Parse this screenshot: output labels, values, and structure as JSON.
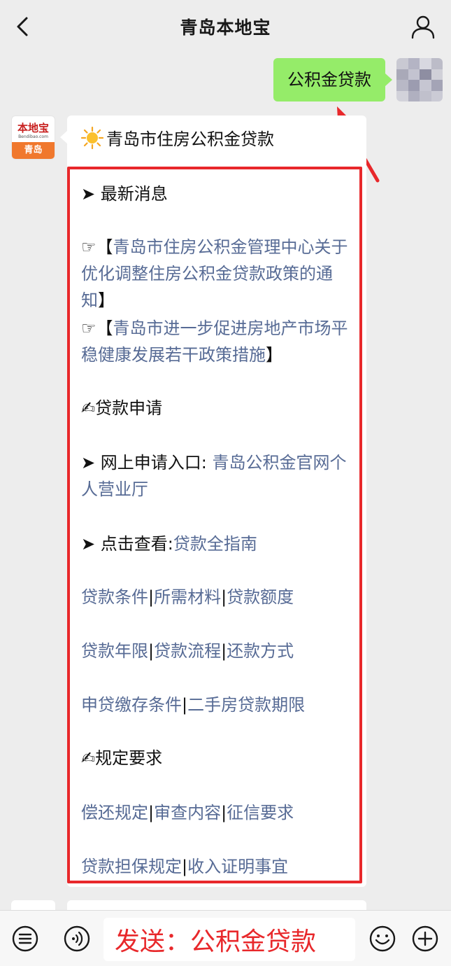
{
  "header": {
    "title": "青岛本地宝"
  },
  "outgoing": {
    "text": "公积金贷款"
  },
  "bot": {
    "logo_top": "本地宝",
    "logo_url": "Bendibao.com",
    "logo_city": "青岛"
  },
  "bubble": {
    "title": "青岛市住房公积金贷款",
    "latest_news": "➤ 最新消息",
    "news_1_prefix": "☞【",
    "news_1": "青岛市住房公积金管理中心关于优化调整住房公积金贷款政策的通知",
    "news_1_suffix": "】",
    "news_2_prefix": "☞【",
    "news_2": "青岛市进一步促进房地产市场平稳健康发展若干政策措施",
    "news_2_suffix": "】",
    "loan_apply": "✍贷款申请",
    "online_label": "➤ 网上申请入口: ",
    "online_link": "青岛公积金官网个人营业厅",
    "guide_label": "➤ 点击查看:",
    "guide_link": "贷款全指南",
    "row1": [
      "贷款条件",
      "所需材料",
      "贷款额度"
    ],
    "row2": [
      "贷款年限",
      "贷款流程",
      "还款方式"
    ],
    "row3": [
      "申贷缴存条件",
      "二手房贷款期限"
    ],
    "rules": "✍规定要求",
    "row4": [
      "偿还规定",
      "审查内容",
      "征信要求"
    ],
    "row5": [
      "贷款担保规定",
      "收入证明事宜"
    ],
    "separator": "|"
  },
  "input": {
    "text": "发送：公积金贷款"
  },
  "colors": {
    "link": "#576b95",
    "outgoing_bubble": "#95ec69",
    "highlight_red": "#e8282b"
  }
}
